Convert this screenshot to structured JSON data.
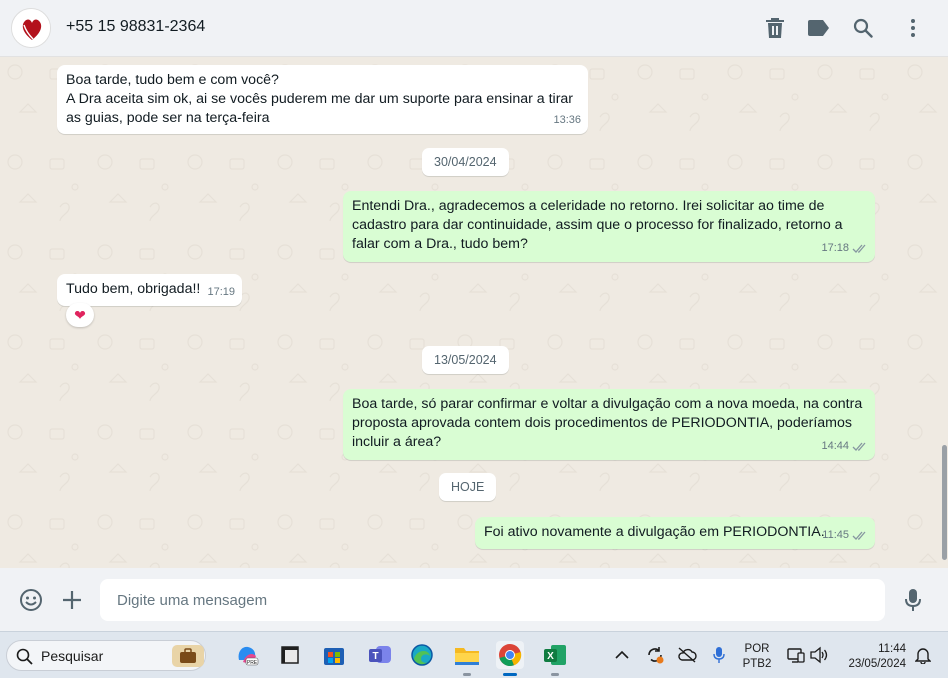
{
  "header": {
    "contact_name": "+55 15 98831-2364",
    "icons": [
      "delete-icon",
      "label-icon",
      "search-icon",
      "menu-dots-icon"
    ]
  },
  "messages": [
    {
      "direction": "in",
      "text": "Boa tarde, tudo bem e com você?\nA Dra aceita sim ok, ai se vocês puderem me dar um suporte para ensinar a tirar as guias, pode ser na terça-feira",
      "time": "13:36"
    },
    {
      "type": "date",
      "label": "30/04/2024"
    },
    {
      "direction": "out",
      "text": "Entendi Dra., agradecemos a celeridade no retorno. Irei solicitar ao time de cadastro para dar continuidade, assim que o processo for finalizado, retorno a falar com a Dra., tudo bem?",
      "time": "17:18"
    },
    {
      "direction": "in",
      "text": "Tudo bem, obrigada!!",
      "time": "17:19",
      "reaction": "❤"
    },
    {
      "type": "date",
      "label": "13/05/2024"
    },
    {
      "direction": "out",
      "text": "Boa tarde, só parar confirmar e voltar a divulgação com a nova moeda, na contra proposta aprovada contem dois procedimentos de PERIODONTIA, poderíamos incluir a área?",
      "time": "14:44"
    },
    {
      "type": "date",
      "label": "HOJE"
    },
    {
      "direction": "out",
      "text": "Foi ativo novamente a divulgação em PERIODONTIA.",
      "time": "11:45"
    }
  ],
  "composer": {
    "placeholder": "Digite uma mensagem",
    "icons": [
      "emoji-icon",
      "plus-icon",
      "microphone-icon"
    ]
  },
  "taskbar": {
    "search_label": "Pesquisar",
    "language": [
      "POR",
      "PTB2"
    ],
    "time": "11:44",
    "date": "23/05/2024"
  },
  "colors": {
    "incoming_bubble": "#ffffff",
    "outgoing_bubble": "#d9fdd3",
    "chat_background": "#efeae2",
    "header_background": "#f0f2f5",
    "read_ticks": "#8696a0"
  }
}
